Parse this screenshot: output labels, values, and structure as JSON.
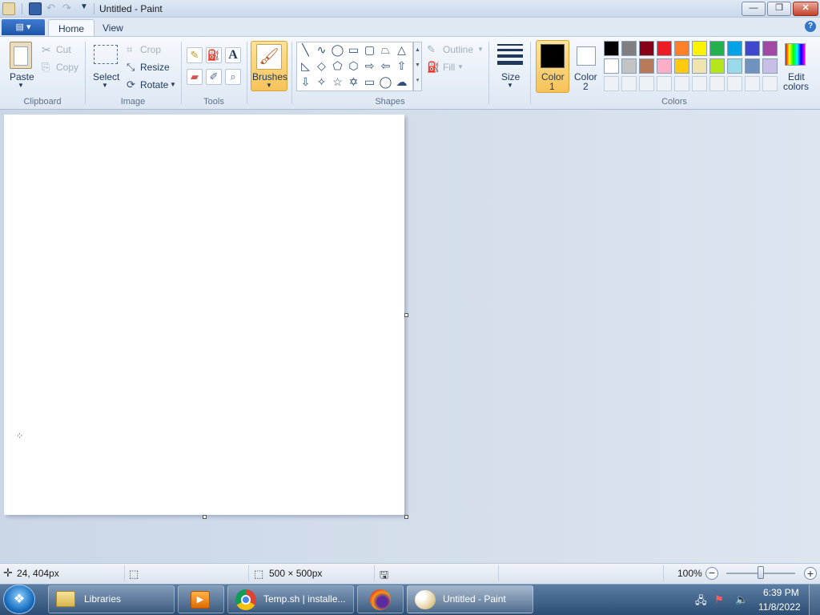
{
  "window": {
    "title": "Untitled - Paint",
    "minimize_glyph": "—",
    "restore_glyph": "❐",
    "close_glyph": "✕"
  },
  "menu": {
    "app_button_glyph": "▤ ▾"
  },
  "tabs": [
    {
      "label": "Home"
    },
    {
      "label": "View"
    }
  ],
  "ribbon": {
    "clipboard": {
      "group": "Clipboard",
      "paste": "Paste",
      "cut": "Cut",
      "copy": "Copy"
    },
    "image": {
      "group": "Image",
      "select": "Select",
      "crop": "Crop",
      "resize": "Resize",
      "rotate": "Rotate"
    },
    "tools": {
      "group": "Tools"
    },
    "brushes": {
      "label": "Brushes"
    },
    "shapes": {
      "group": "Shapes",
      "outline": "Outline",
      "fill": "Fill"
    },
    "size": {
      "label": "Size"
    },
    "colors": {
      "group": "Colors",
      "color1_line1": "Color",
      "color1_line2": "1",
      "color2_line1": "Color",
      "color2_line2": "2",
      "edit_line1": "Edit",
      "edit_line2": "colors",
      "color1_value": "#000000",
      "color2_value": "#ffffff",
      "row1": [
        "#000000",
        "#7f7f7f",
        "#880015",
        "#ed1c24",
        "#ff7f27",
        "#fff200",
        "#22b14c",
        "#00a2e8",
        "#3f48cc",
        "#a349a4"
      ],
      "row2": [
        "#ffffff",
        "#c3c3c3",
        "#b97a57",
        "#ffaec9",
        "#ffc90e",
        "#efe4b0",
        "#b5e61d",
        "#99d9ea",
        "#7092be",
        "#c8bfe7"
      ]
    }
  },
  "status": {
    "cursor_pos": "24, 404px",
    "canvas_size": "500 × 500px",
    "zoom": "100%",
    "zoom_level": 1.0
  },
  "taskbar": {
    "items": [
      {
        "label": "Libraries"
      },
      {
        "label": "Temp.sh | installe..."
      },
      {
        "label": "Untitled - Paint"
      }
    ],
    "time": "6:39 PM",
    "date": "11/8/2022"
  }
}
